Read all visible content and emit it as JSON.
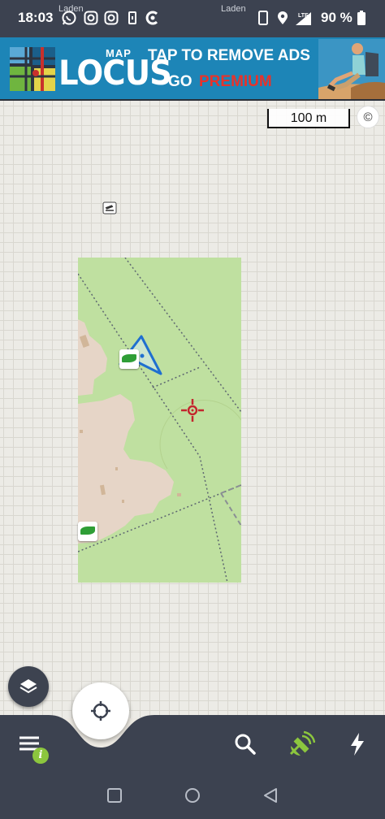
{
  "status_bar": {
    "time": "18:03",
    "laden_left": "Laden",
    "laden_right": "Laden",
    "battery_percent": "90 %",
    "network": "LTE",
    "icons": [
      "whatsapp-icon",
      "instagram-icon",
      "instagram-icon",
      "sim-icon",
      "app-icon",
      "phone-icon",
      "location-icon",
      "signal-icon",
      "battery-icon"
    ]
  },
  "ad_banner": {
    "brand_small": "MAP",
    "brand": "LOCUS",
    "headline": "TAP TO REMOVE ADS",
    "go": "GO",
    "premium": "PREMIUM",
    "colors": {
      "background": "#1d85b7",
      "premium": "#e8322a"
    }
  },
  "map": {
    "scale_label": "100 m",
    "copyright_symbol": "©",
    "colors": {
      "meadow": "#bfe0a0",
      "urban": "#e6d5c7",
      "cursor": "#c4262e",
      "track": "#1f6fd0"
    }
  },
  "bottom_bar": {
    "info_badge": "i",
    "buttons": [
      "menu-icon",
      "search-icon",
      "gps-satellite-icon",
      "lightning-icon"
    ],
    "accent": "#8cc63e"
  },
  "nav_bar": {
    "buttons": [
      "recent-apps-icon",
      "home-icon",
      "back-icon"
    ]
  }
}
